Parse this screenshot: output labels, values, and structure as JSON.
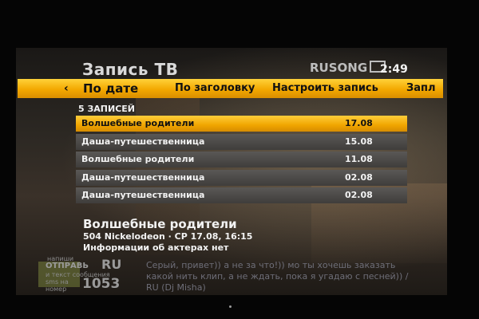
{
  "header": {
    "title": "Запись ТВ",
    "logo": "RUSONG",
    "clock": "2:49"
  },
  "tabs": {
    "prev_arrow": "‹",
    "items": [
      {
        "label": "По дате",
        "active": true
      },
      {
        "label": "По заголовку"
      },
      {
        "label": "Настроить запись"
      },
      {
        "label": "Запл"
      }
    ]
  },
  "list": {
    "count_label": "5 ЗАПИСЕЙ",
    "rows": [
      {
        "title": "Волшебные родители",
        "date": "17.08",
        "selected": true
      },
      {
        "title": "Даша-путешественница",
        "date": "15.08"
      },
      {
        "title": "Волшебные родители",
        "date": "11.08"
      },
      {
        "title": "Даша-путешественница",
        "date": "02.08"
      },
      {
        "title": "Даша-путешественница",
        "date": "02.08"
      }
    ]
  },
  "details": {
    "title": "Волшебные родители",
    "channel_line": "504 Nickelodeon  ·  СР 17.08, 16:15",
    "actors_line": "Информации об актерах нет"
  },
  "sms_banner": {
    "line1": "напиши",
    "line2": "и текст сообщения",
    "line3": "sms на",
    "line4": "номер",
    "send": "ОТПРАВЬ",
    "code": "RU",
    "number": "1053"
  },
  "ticker": {
    "text": "Серый, привет)) а не за что!)) мо ты хочешь заказать какой нить клип, а не ждать, пока я угадаю с песней)) / RU (Dj Misha)"
  },
  "colors": {
    "accent": "#f3a800",
    "row_bg": "#4a4846",
    "text": "#f2f2f2"
  }
}
